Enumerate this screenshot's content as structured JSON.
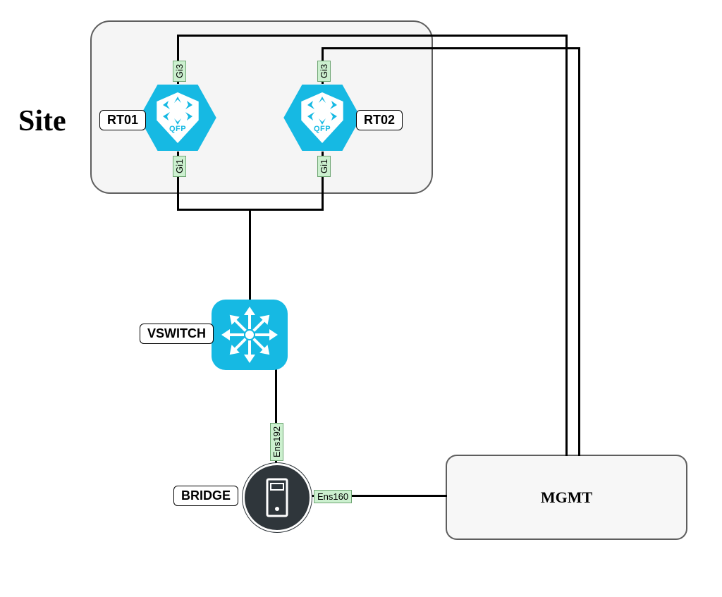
{
  "site": {
    "title": "Site",
    "routers": {
      "rt01": {
        "label": "RT01",
        "top_if": "Gi3",
        "bottom_if": "Gi1",
        "qfp": "QFP"
      },
      "rt02": {
        "label": "RT02",
        "top_if": "Gi3",
        "bottom_if": "Gi1",
        "qfp": "QFP"
      }
    }
  },
  "vswitch": {
    "label": "VSWITCH"
  },
  "bridge": {
    "label": "BRIDGE",
    "top_if": "Ens192",
    "right_if": "Ens160"
  },
  "mgmt": {
    "label": "MGMT"
  },
  "colors": {
    "accent": "#16b9e3",
    "iface_bg": "#ccf0cf",
    "dark": "#2f363b"
  }
}
